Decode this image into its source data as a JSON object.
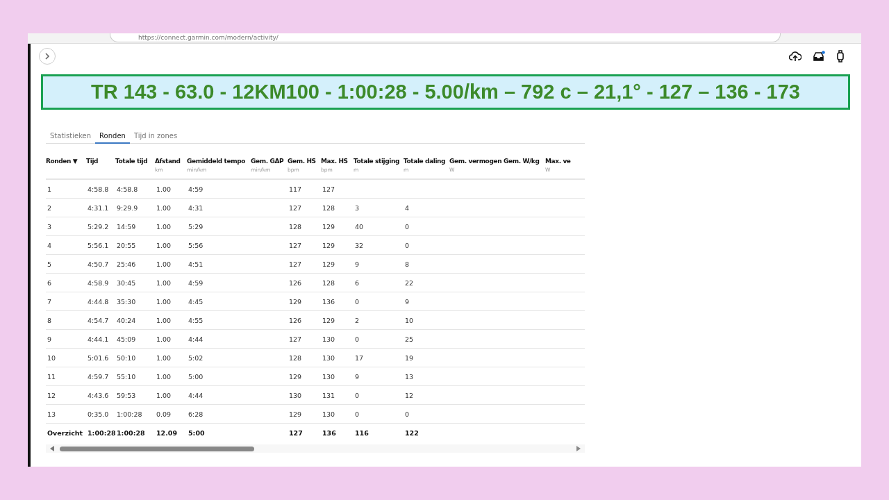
{
  "browser": {
    "url": "https://connect.garmin.com/modern/activity/"
  },
  "banner": {
    "title": "TR 143 - 63.0 - 12KM100 - 1:00:28 - 5.00/km – 792 c – 21,1° - 127 – 136 - 173"
  },
  "tabs": [
    {
      "label": "Statistieken",
      "selected": false
    },
    {
      "label": "Ronden",
      "selected": true
    },
    {
      "label": "Tijd in zones",
      "selected": false
    }
  ],
  "table": {
    "columns": [
      {
        "label": "Ronden ▼"
      },
      {
        "label": "Tijd"
      },
      {
        "label": "Totale tijd"
      },
      {
        "label": "Afstand",
        "unit": "km"
      },
      {
        "label": "Gemiddeld tempo",
        "unit": "min/km"
      },
      {
        "label": "Gem. GAP",
        "unit": "min/km"
      },
      {
        "label": "Gem. HS",
        "unit": "bpm"
      },
      {
        "label": "Max. HS",
        "unit": "bpm"
      },
      {
        "label": "Totale stijging",
        "unit": "m"
      },
      {
        "label": "Totale daling",
        "unit": "m"
      },
      {
        "label": "Gem. vermogen",
        "unit": "W"
      },
      {
        "label": "Gem. W/kg"
      },
      {
        "label": "Max. ve",
        "unit": "W"
      }
    ],
    "rows": [
      {
        "lap": "1",
        "time": "4:58.8",
        "total_time": "4:58.8",
        "distance": "1.00",
        "pace": "4:59",
        "avg_hr": "117",
        "max_hr": "127"
      },
      {
        "lap": "2",
        "time": "4:31.1",
        "total_time": "9:29.9",
        "distance": "1.00",
        "pace": "4:31",
        "avg_hr": "127",
        "max_hr": "128",
        "ascent": "3",
        "descent": "4"
      },
      {
        "lap": "3",
        "time": "5:29.2",
        "total_time": "14:59",
        "distance": "1.00",
        "pace": "5:29",
        "avg_hr": "128",
        "max_hr": "129",
        "ascent": "40",
        "descent": "0"
      },
      {
        "lap": "4",
        "time": "5:56.1",
        "total_time": "20:55",
        "distance": "1.00",
        "pace": "5:56",
        "avg_hr": "127",
        "max_hr": "129",
        "ascent": "32",
        "descent": "0"
      },
      {
        "lap": "5",
        "time": "4:50.7",
        "total_time": "25:46",
        "distance": "1.00",
        "pace": "4:51",
        "avg_hr": "127",
        "max_hr": "129",
        "ascent": "9",
        "descent": "8"
      },
      {
        "lap": "6",
        "time": "4:58.9",
        "total_time": "30:45",
        "distance": "1.00",
        "pace": "4:59",
        "avg_hr": "126",
        "max_hr": "128",
        "ascent": "6",
        "descent": "22"
      },
      {
        "lap": "7",
        "time": "4:44.8",
        "total_time": "35:30",
        "distance": "1.00",
        "pace": "4:45",
        "avg_hr": "129",
        "max_hr": "136",
        "ascent": "0",
        "descent": "9"
      },
      {
        "lap": "8",
        "time": "4:54.7",
        "total_time": "40:24",
        "distance": "1.00",
        "pace": "4:55",
        "avg_hr": "126",
        "max_hr": "129",
        "ascent": "2",
        "descent": "10"
      },
      {
        "lap": "9",
        "time": "4:44.1",
        "total_time": "45:09",
        "distance": "1.00",
        "pace": "4:44",
        "avg_hr": "127",
        "max_hr": "130",
        "ascent": "0",
        "descent": "25"
      },
      {
        "lap": "10",
        "time": "5:01.6",
        "total_time": "50:10",
        "distance": "1.00",
        "pace": "5:02",
        "avg_hr": "128",
        "max_hr": "130",
        "ascent": "17",
        "descent": "19"
      },
      {
        "lap": "11",
        "time": "4:59.7",
        "total_time": "55:10",
        "distance": "1.00",
        "pace": "5:00",
        "avg_hr": "129",
        "max_hr": "130",
        "ascent": "9",
        "descent": "13"
      },
      {
        "lap": "12",
        "time": "4:43.6",
        "total_time": "59:53",
        "distance": "1.00",
        "pace": "4:44",
        "avg_hr": "130",
        "max_hr": "131",
        "ascent": "0",
        "descent": "12"
      },
      {
        "lap": "13",
        "time": "0:35.0",
        "total_time": "1:00:28",
        "distance": "0.09",
        "pace": "6:28",
        "avg_hr": "129",
        "max_hr": "130",
        "ascent": "0",
        "descent": "0"
      }
    ],
    "summary": {
      "lap": "Overzicht",
      "time": "1:00:28",
      "total_time": "1:00:28",
      "distance": "12.09",
      "pace": "5:00",
      "avg_hr": "127",
      "max_hr": "136",
      "ascent": "116",
      "descent": "122"
    }
  }
}
